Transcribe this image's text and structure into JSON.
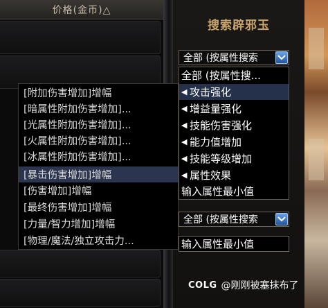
{
  "list": {
    "column_header": "价格(金币)△"
  },
  "search_panel": {
    "title": "搜索辟邪玉",
    "select1_value": "全部 (按属性搜索",
    "select2_value": "全部 (按属性搜索",
    "min_value_placeholder": "输入属性最小值"
  },
  "dropdown": {
    "items": [
      {
        "label": "全部 (按属性搜...",
        "arrow": false,
        "highlighted": false
      },
      {
        "label": "攻击强化",
        "arrow": true,
        "highlighted": true
      },
      {
        "label": "增益量强化",
        "arrow": true,
        "highlighted": false
      },
      {
        "label": "技能伤害强化",
        "arrow": true,
        "highlighted": false
      },
      {
        "label": "能力值增加",
        "arrow": true,
        "highlighted": false
      },
      {
        "label": "技能等级增加",
        "arrow": true,
        "highlighted": false
      },
      {
        "label": "属性效果",
        "arrow": true,
        "highlighted": false
      },
      {
        "label": "输入属性最小值",
        "arrow": false,
        "highlighted": false
      }
    ]
  },
  "submenu": {
    "items": [
      {
        "label": "[附加伤害增加]增幅",
        "highlighted": false
      },
      {
        "label": "[暗属性附加伤害增加]...",
        "highlighted": false
      },
      {
        "label": "[光属性附加伤害增加]...",
        "highlighted": false
      },
      {
        "label": "[火属性附加伤害增加]...",
        "highlighted": false
      },
      {
        "label": "[冰属性附加伤害增加]...",
        "highlighted": false
      },
      {
        "label": "[暴击伤害增加]增幅",
        "highlighted": true
      },
      {
        "label": "[伤害增加]增幅",
        "highlighted": false
      },
      {
        "label": "[最终伤害增加]增幅",
        "highlighted": false
      },
      {
        "label": "[力量/智力增加]增幅",
        "highlighted": false
      },
      {
        "label": "[物理/魔法/独立攻击力...",
        "highlighted": false
      }
    ]
  },
  "watermark": {
    "logo": "COLG",
    "text": "@刚刚被塞抹布了"
  },
  "icons": {
    "dropdown_arrow": "chevron-down-icon",
    "submenu_arrow": "triangle-left-icon"
  },
  "colors": {
    "highlight": "#25304a",
    "title": "#c8a46a",
    "dropdown_button": "#3f7fd0"
  }
}
